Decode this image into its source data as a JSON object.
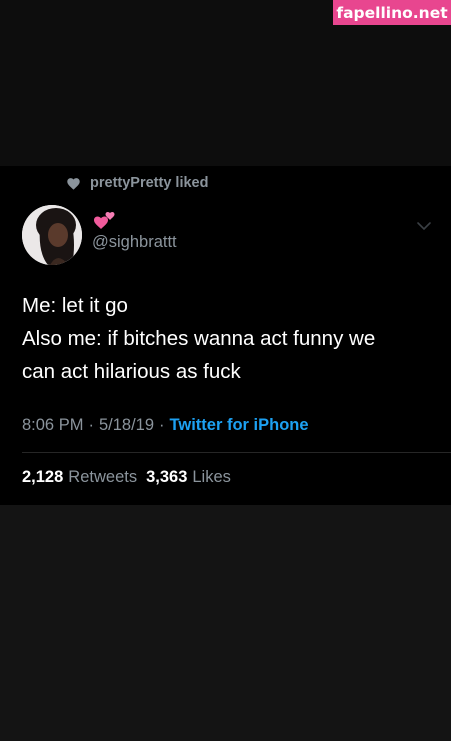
{
  "watermark": "fapellino.net",
  "social_context": {
    "text": "prettyPretty liked",
    "icon": "heart-icon"
  },
  "author": {
    "display_name_emoji": "💕",
    "handle": "@sighbrattt"
  },
  "tweet": {
    "lines": [
      "Me: let it go",
      "Also me: if bitches wanna act funny we",
      "can act hilarious as fuck"
    ]
  },
  "meta": {
    "time": "8:06 PM",
    "separator": "·",
    "date": "5/18/19",
    "source": "Twitter for iPhone"
  },
  "stats": {
    "retweets_count": "2,128",
    "retweets_label": "Retweets",
    "likes_count": "3,363",
    "likes_label": "Likes"
  },
  "colors": {
    "watermark_bg": "#e8468f",
    "link_blue": "#1da1f2",
    "muted_gray": "#8b949c",
    "card_bg": "#000000"
  }
}
